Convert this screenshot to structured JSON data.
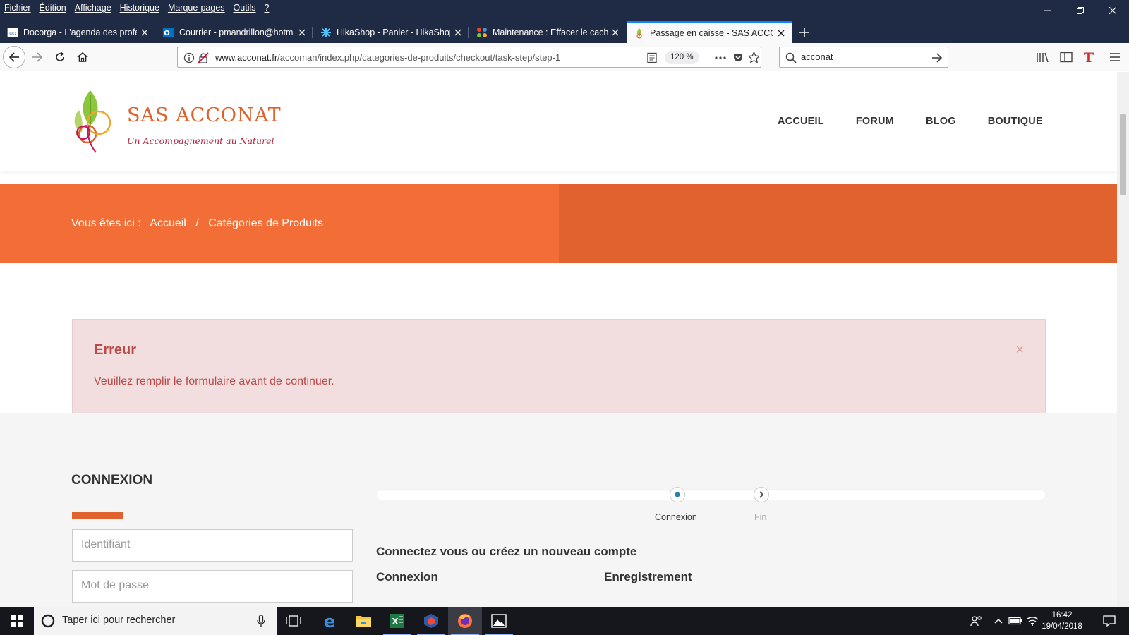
{
  "browser": {
    "menu": [
      "Fichier",
      "Édition",
      "Affichage",
      "Historique",
      "Marque-pages",
      "Outils",
      "?"
    ],
    "tabs": [
      {
        "title": "Docorga - L'agenda des professionnels",
        "icon": "docorga-icon"
      },
      {
        "title": "Courrier - pmandrillon@hotmail.fr",
        "icon": "outlook-icon"
      },
      {
        "title": "HikaShop - Panier - HikaShop",
        "icon": "hikashop-icon"
      },
      {
        "title": "Maintenance : Effacer le cache",
        "icon": "joomla-icon"
      },
      {
        "title": "Passage en caisse - SAS ACCONAT",
        "icon": "acconat-icon",
        "active": true
      }
    ],
    "url_domain": "www.acconat.fr",
    "url_path": "/accoman/index.php/categories-de-produits/checkout/task-step/step-1",
    "zoom": "120 %",
    "search_value": "acconat",
    "accent_color": "#0a84ff"
  },
  "site": {
    "logo_title": "SAS ACCONAT",
    "logo_subtitle": "Un Accompagnement au Naturel",
    "nav": [
      "ACCUEIL",
      "FORUM",
      "BLOG",
      "BOUTIQUE"
    ],
    "breadcrumb": {
      "prefix": "Vous êtes ici :",
      "items": [
        "Accueil",
        "Catégories de Produits"
      ],
      "separator": "/"
    },
    "banner_color": "#f26e36",
    "alert": {
      "title": "Erreur",
      "message": "Veuillez remplir le formulaire avant de continuer.",
      "close": "×"
    },
    "login": {
      "title": "CONNEXION",
      "username_placeholder": "Identifiant",
      "password_placeholder": "Mot de passe"
    },
    "checkout": {
      "steps": [
        {
          "label": "Connexion",
          "current": true
        },
        {
          "label": "Fin",
          "current": false
        }
      ],
      "heading": "Connectez vous ou créez un nouveau compte",
      "col_login": "Connexion",
      "col_register": "Enregistrement"
    }
  },
  "taskbar": {
    "search_placeholder": "Taper ici pour rechercher",
    "apps": [
      "task-view-icon",
      "edge-icon",
      "file-explorer-icon",
      "excel-icon",
      "app-icon",
      "firefox-icon",
      "photos-icon"
    ],
    "time": "16:42",
    "date": "19/04/2018"
  }
}
